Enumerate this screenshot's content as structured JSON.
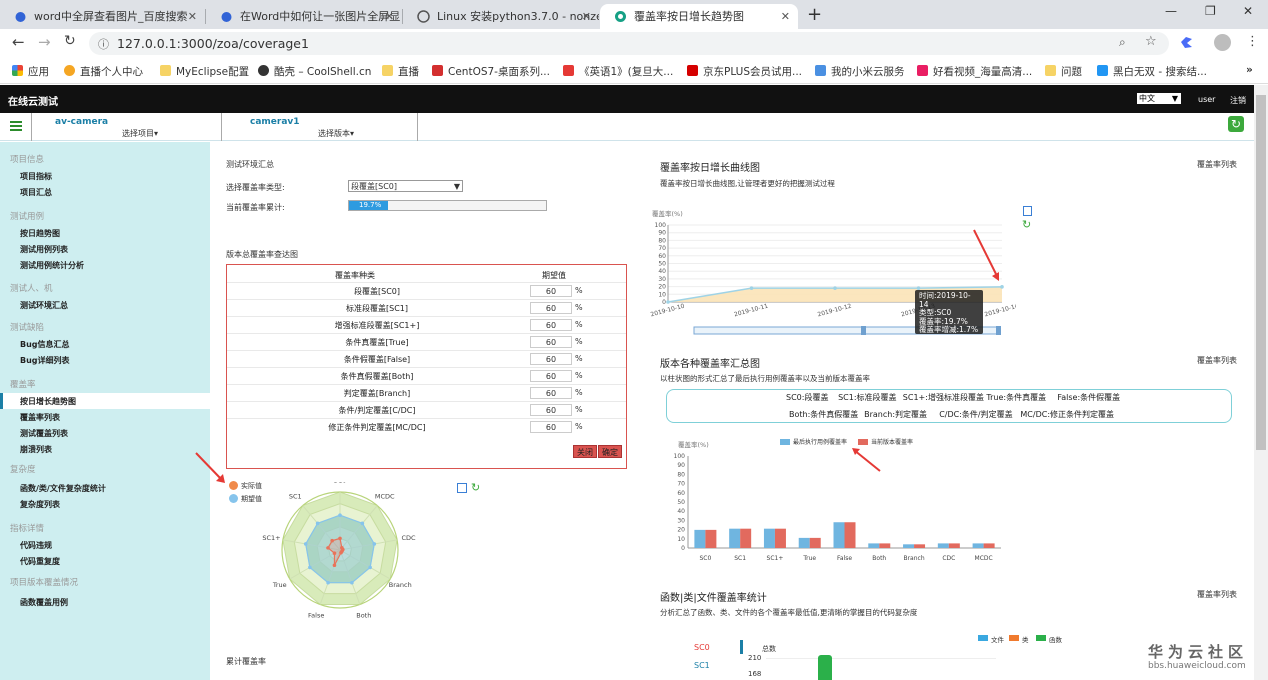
{
  "browser": {
    "tabs": [
      {
        "title": "word中全屏查看图片_百度搜索"
      },
      {
        "title": "在Word中如何让一张图片全屏显"
      },
      {
        "title": "Linux 安装python3.7.0 - nonze"
      },
      {
        "title": "覆盖率按日增长趋势图"
      }
    ],
    "url": "127.0.0.1:3000/zoa/coverage1",
    "bookmarks": [
      "应用",
      "直播个人中心",
      "MyEclipse配置",
      "酷壳 – CoolShell.cn",
      "直播",
      "CentOS7-桌面系列...",
      "《英语1》(复旦大...",
      "京东PLUS会员试用...",
      "我的小米云服务",
      "好看视频_海量高清...",
      "问题",
      "黑白无双 - 搜索结..."
    ]
  },
  "app": {
    "title": "在线云测试",
    "lang": "中文",
    "user": "user",
    "logout": "注销",
    "project": {
      "name": "av-camera",
      "select": "选择项目▾"
    },
    "version": {
      "name": "camerav1",
      "select": "选择版本▾"
    }
  },
  "sidebar": {
    "sections": [
      {
        "title": "项目信息",
        "items": [
          "项目指标",
          "项目汇总"
        ]
      },
      {
        "title": "测试用例",
        "items": [
          "按日趋势图",
          "测试用例列表",
          "测试用例统计分析"
        ]
      },
      {
        "title": "测试人、机",
        "items": [
          "测试环境汇总"
        ]
      },
      {
        "title": "测试缺陷",
        "items": [
          "Bug信息汇总",
          "Bug详细列表"
        ]
      },
      {
        "title": "覆盖率",
        "items": [
          "按日增长趋势图",
          "覆盖率列表",
          "测试覆盖列表",
          "崩溃列表"
        ]
      },
      {
        "title": "复杂度",
        "items": [
          "函数/类/文件复杂度统计",
          "复杂度列表"
        ]
      },
      {
        "title": "指标详情",
        "items": [
          "代码违规",
          "代码重复度"
        ]
      },
      {
        "title": "项目版本覆盖情况",
        "items": [
          "函数覆盖用例"
        ]
      }
    ]
  },
  "env": {
    "heading": "测试环境汇总",
    "type_label": "选择覆盖率类型:",
    "type_value": "段覆盖[SC0]",
    "cumulative_label": "当前覆盖率累计:",
    "cumulative_value": "19.7%",
    "cumulative_fraction": 0.197
  },
  "expect": {
    "heading": "版本总覆盖率查达图",
    "col1": "覆盖率种类",
    "col2": "期望值",
    "rows": [
      {
        "name": "段覆盖[SC0]",
        "value": "60"
      },
      {
        "name": "标准段覆盖[SC1]",
        "value": "60"
      },
      {
        "name": "增强标准段覆盖[SC1+]",
        "value": "60"
      },
      {
        "name": "条件真覆盖[True]",
        "value": "60"
      },
      {
        "name": "条件假覆盖[False]",
        "value": "60"
      },
      {
        "name": "条件真假覆盖[Both]",
        "value": "60"
      },
      {
        "name": "判定覆盖[Branch]",
        "value": "60"
      },
      {
        "name": "条件/判定覆盖[C/DC]",
        "value": "60"
      },
      {
        "name": "修正条件判定覆盖[MC/DC]",
        "value": "60"
      }
    ],
    "unit": "%",
    "close": "关闭",
    "ok": "确定"
  },
  "radar": {
    "legend_actual": "实际值",
    "legend_expect": "期望值",
    "axes": [
      "SC0",
      "MCDC",
      "CDC",
      "Branch",
      "Both",
      "False",
      "True",
      "SC1+",
      "SC1"
    ],
    "bottom_link": "累计覆盖率"
  },
  "daily": {
    "heading": "覆盖率按日增长曲线图",
    "link": "覆盖率列表",
    "desc": "覆盖率按日增长曲线图,让管理者更好的把握测试过程",
    "yname": "覆盖率(%)",
    "yticks": [
      "100",
      "90",
      "80",
      "70",
      "60",
      "50",
      "40",
      "30",
      "20",
      "10",
      "0"
    ],
    "xdates": [
      "2019-10-10",
      "2019-10-11",
      "2019-10-12",
      "2019-10-13",
      "2019-10-14"
    ],
    "tooltip": {
      "time": "时间:2019-10-14",
      "type": "类型:SC0",
      "rate": "覆盖率:19.7%",
      "inc": "覆盖率增减:1.7%"
    }
  },
  "versionSum": {
    "heading": "版本各种覆盖率汇总图",
    "link": "覆盖率列表",
    "desc": "以柱状图的形式汇总了最后执行用例覆盖率以及当前版本覆盖率",
    "defs1": [
      "SC0:段覆盖",
      "SC1:标准段覆盖",
      "SC1+:增强标准段覆盖",
      "True:条件真覆盖",
      "False:条件假覆盖"
    ],
    "defs2": [
      "Both:条件真假覆盖",
      "Branch:判定覆盖",
      "C/DC:条件/判定覆盖",
      "MC/DC:修正条件判定覆盖"
    ],
    "yname": "覆盖率(%)",
    "legend1": "最后执行用例覆盖率",
    "legend2": "当前版本覆盖率"
  },
  "complex": {
    "heading": "函数|类|文件覆盖率统计",
    "link": "覆盖率列表",
    "desc": "分析汇总了函数、类、文件的各个覆盖率最低值,更清晰的掌握目的代码复杂度",
    "side": [
      "SC0",
      "SC1"
    ],
    "yname": "总数",
    "legend": [
      "文件",
      "类",
      "函数"
    ],
    "ticks": [
      "210",
      "168"
    ]
  },
  "watermark": {
    "title": "华为云社区",
    "url": "bbs.huaweicloud.com"
  },
  "colors": {
    "accent": "#1b7fa6",
    "sidebar": "#ceeef0",
    "blueSeries": "#6fb5e0",
    "redSeries": "#e26a5e"
  },
  "chart_data": [
    {
      "type": "area",
      "title": "覆盖率按日增长曲线图",
      "ylabel": "覆盖率(%)",
      "x": [
        "2019-10-10",
        "2019-10-11",
        "2019-10-12",
        "2019-10-13",
        "2019-10-14"
      ],
      "series": [
        {
          "name": "SC0",
          "values": [
            0,
            18,
            18,
            18,
            19.7
          ]
        }
      ],
      "ylim": [
        0,
        100
      ]
    },
    {
      "type": "bar",
      "title": "版本各种覆盖率汇总图",
      "ylabel": "覆盖率(%)",
      "categories": [
        "SC0",
        "SC1",
        "SC1+",
        "True",
        "False",
        "Both",
        "Branch",
        "CDC",
        "MCDC"
      ],
      "series": [
        {
          "name": "最后执行用例覆盖率",
          "values": [
            19.7,
            21,
            21,
            11,
            28,
            5,
            4,
            5,
            5
          ]
        },
        {
          "name": "当前版本覆盖率",
          "values": [
            19.7,
            21,
            21,
            11,
            28,
            5,
            4,
            5,
            5
          ]
        }
      ],
      "ylim": [
        0,
        100
      ]
    },
    {
      "type": "area",
      "title": "",
      "categories": [
        "SC0",
        "MCDC",
        "CDC",
        "Branch",
        "Both",
        "False",
        "True",
        "SC1+",
        "SC1"
      ],
      "series": [
        {
          "name": "实际值",
          "values": [
            20,
            5,
            5,
            4,
            5,
            28,
            11,
            21,
            21
          ]
        },
        {
          "name": "期望值",
          "values": [
            60,
            60,
            60,
            60,
            60,
            60,
            60,
            60,
            60
          ]
        }
      ],
      "ylim": [
        0,
        100
      ]
    }
  ]
}
